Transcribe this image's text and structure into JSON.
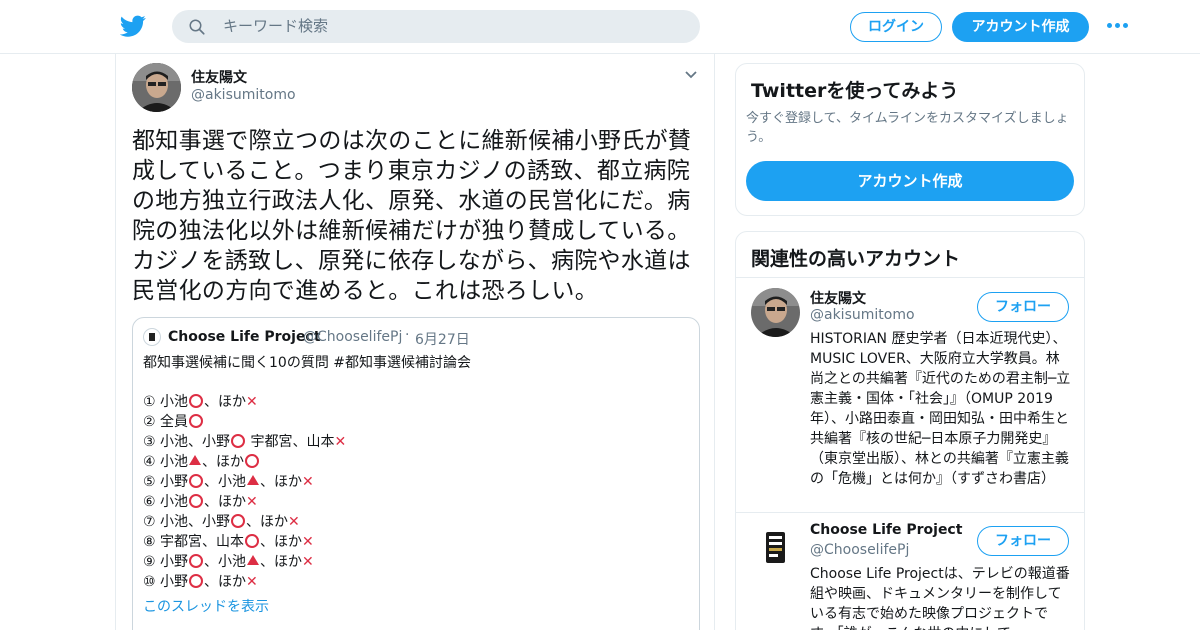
{
  "header": {
    "search_placeholder": "キーワード検索",
    "login_label": "ログイン",
    "signup_label": "アカウント作成"
  },
  "tweet": {
    "author_name": "住友陽文",
    "author_handle": "@akisumitomo",
    "lines": [
      "都知事選で際立つのは次のことに維新候補小野氏が賛",
      "成していること。つまり東京カジノの誘致、都立病院",
      "の地方独立行政法人化、原発、水道の民営化にだ。病",
      "院の独法化以外は維新候補だけが独り賛成している。",
      "カジノを誘致し、原発に依存しながら、病院や水道は",
      "民営化の方向で進めると。これは恐ろしい。"
    ]
  },
  "quoted": {
    "name": "Choose Life Project",
    "handle": "@ChooselifePj",
    "separator": "·",
    "date": "6月27日",
    "text": "都知事選候補に聞く10の質問 #都知事選候補討論会",
    "items": [
      [
        "① 小池",
        "o",
        "、ほか",
        "x"
      ],
      [
        "② 全員",
        "o"
      ],
      [
        "③ 小池、小野",
        "o",
        " 宇都宮、山本",
        "x"
      ],
      [
        "④ 小池",
        "t",
        "、ほか",
        "o"
      ],
      [
        "⑤ 小野",
        "o",
        "、小池",
        "t",
        "、ほか",
        "x"
      ],
      [
        "⑥ 小池",
        "o",
        "、ほか",
        "x"
      ],
      [
        "⑦ 小池、小野",
        "o",
        "、ほか",
        "x"
      ],
      [
        "⑧ 宇都宮、山本",
        "o",
        "、ほか",
        "x"
      ],
      [
        "⑨ 小野",
        "o",
        "、小池",
        "t",
        "、ほか",
        "x"
      ],
      [
        "⑩ 小野",
        "o",
        "、ほか",
        "x"
      ]
    ],
    "show_thread": "このスレッドを表示"
  },
  "try_card": {
    "title": "Twitterを使ってみよう",
    "desc": "今すぐ登録して、タイムラインをカスタマイズしましょう。",
    "button": "アカウント作成"
  },
  "related": {
    "title": "関連性の高いアカウント",
    "accounts": [
      {
        "name": "住友陽文",
        "handle": "@akisumitomo",
        "follow": "フォロー",
        "bio": "HISTORIAN 歴史学者（日本近現代史）、MUSIC LOVER、大阪府立大学教員。林尚之との共編著『近代のための君主制─立憲主義・国体・「社会」』（OMUP 2019年）、小路田泰直・岡田知弘・田中希生と共編著『核の世紀─日本原子力開発史』（東京堂出版）、林との共編著『立憲主義の「危機」とは何か』（すずさわ書店）"
      },
      {
        "name": "Choose Life Project",
        "handle": "@ChooselifePj",
        "follow": "フォロー",
        "bio": "Choose Life Projectは、テレビの報道番組や映画、ドキュメンタリーを制作している有志で始めた映像プロジェクトです。「誰が、こんな世の中にして"
      }
    ]
  },
  "colors": {
    "brand": "#1da1f2",
    "mark_red": "#dd2e44",
    "secondary_text": "#657786"
  },
  "icons": [
    "twitter-bird-icon",
    "search-icon",
    "more-dots-icon",
    "chevron-down-icon",
    "red-circle-icon",
    "cross-mark-icon",
    "red-triangle-icon"
  ]
}
